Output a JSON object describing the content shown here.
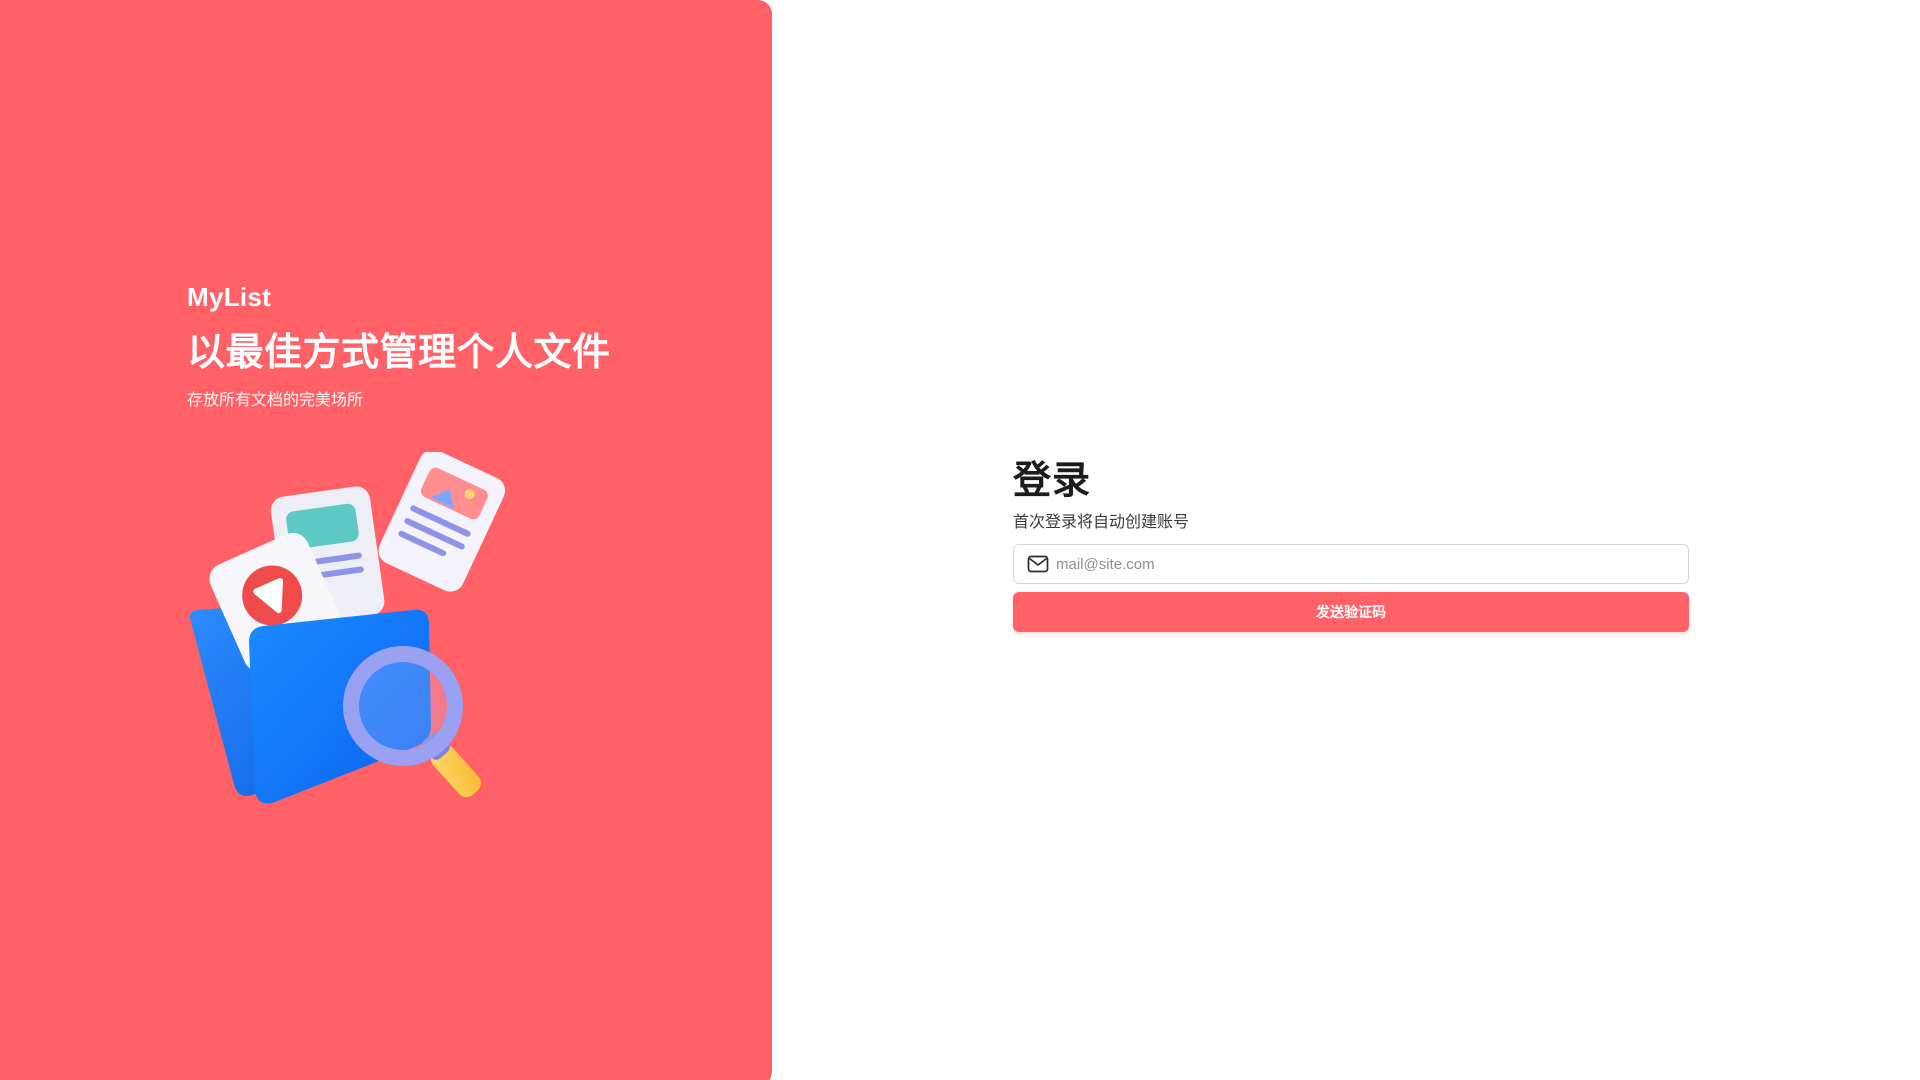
{
  "colors": {
    "brand": "#ff6167",
    "text_dark": "#1c1c1e",
    "text_muted": "#3a3a3c",
    "placeholder": "#8e8e93",
    "border": "#d4d4d8"
  },
  "hero": {
    "brand_name": "MyList",
    "headline": "以最佳方式管理个人文件",
    "tagline": "存放所有文档的完美场所",
    "illustration_icon": "folder-with-documents-and-magnifier-icon"
  },
  "login": {
    "title": "登录",
    "subtitle": "首次登录将自动创建账号",
    "email": {
      "icon": "mail-icon",
      "placeholder": "mail@site.com",
      "value": ""
    },
    "submit_label": "发送验证码"
  }
}
